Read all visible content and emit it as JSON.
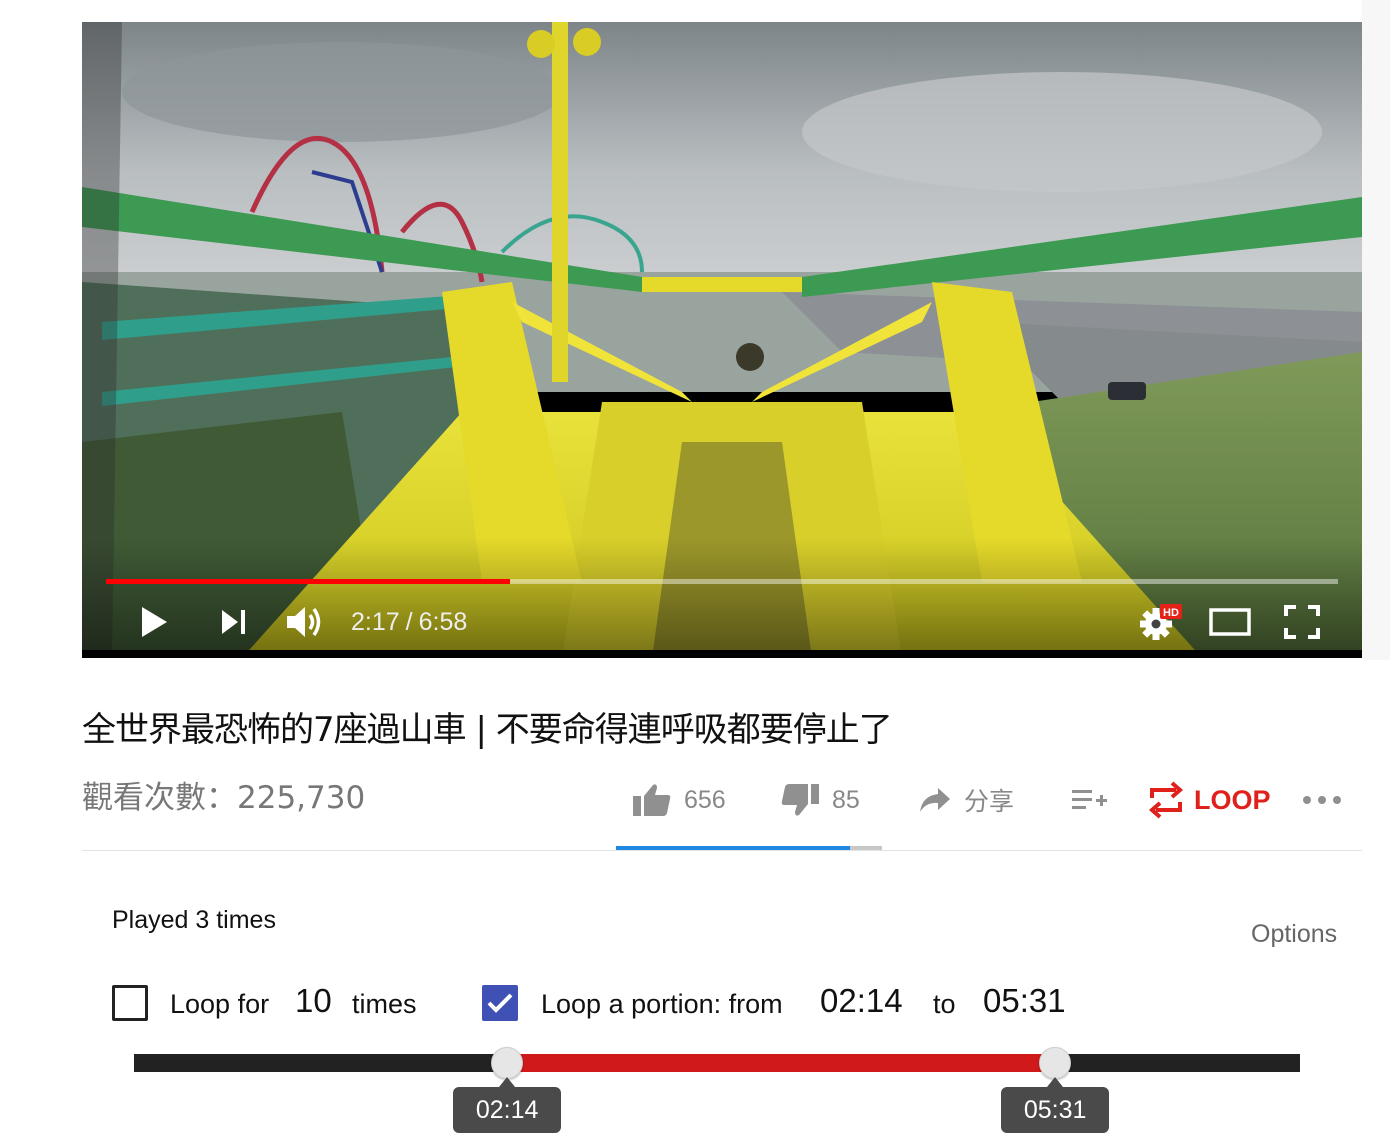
{
  "video": {
    "progress_fraction": 0.328,
    "current_time": "2:17",
    "time_separator": "/",
    "duration": "6:58",
    "quality_badge": "HD",
    "controls": {
      "play_icon": "play-icon",
      "next_icon": "next-icon",
      "volume_icon": "volume-icon",
      "settings_icon": "gear-icon",
      "theater_icon": "theater-mode-icon",
      "fullscreen_icon": "fullscreen-icon"
    }
  },
  "title": "全世界最恐怖的7座過山車 | 不要命得連呼吸都要停止了",
  "views": "觀看次數：225,730",
  "actions": {
    "like_count": "656",
    "dislike_count": "85",
    "share_label": "分享",
    "loop_label": "LOOP",
    "like_fraction": 0.88
  },
  "loop_panel": {
    "played_text": "Played 3 times",
    "options_label": "Options",
    "loop_for_checked": false,
    "loop_for_prefix": "Loop for",
    "loop_for_count": "10",
    "loop_for_suffix": "times",
    "portion_checked": true,
    "portion_prefix": "Loop a portion: from",
    "portion_from": "02:14",
    "portion_to_word": "to",
    "portion_to": "05:31",
    "range_start_fraction": 0.32,
    "range_end_fraction": 0.79,
    "tooltip_from": "02:14",
    "tooltip_to": "05:31"
  },
  "colors": {
    "accent_red": "#e0201b",
    "progress_red": "#ff0000",
    "range_red": "#d0191b",
    "checkbox_blue": "#3f51b5",
    "like_bar_blue": "#1e88e5"
  }
}
